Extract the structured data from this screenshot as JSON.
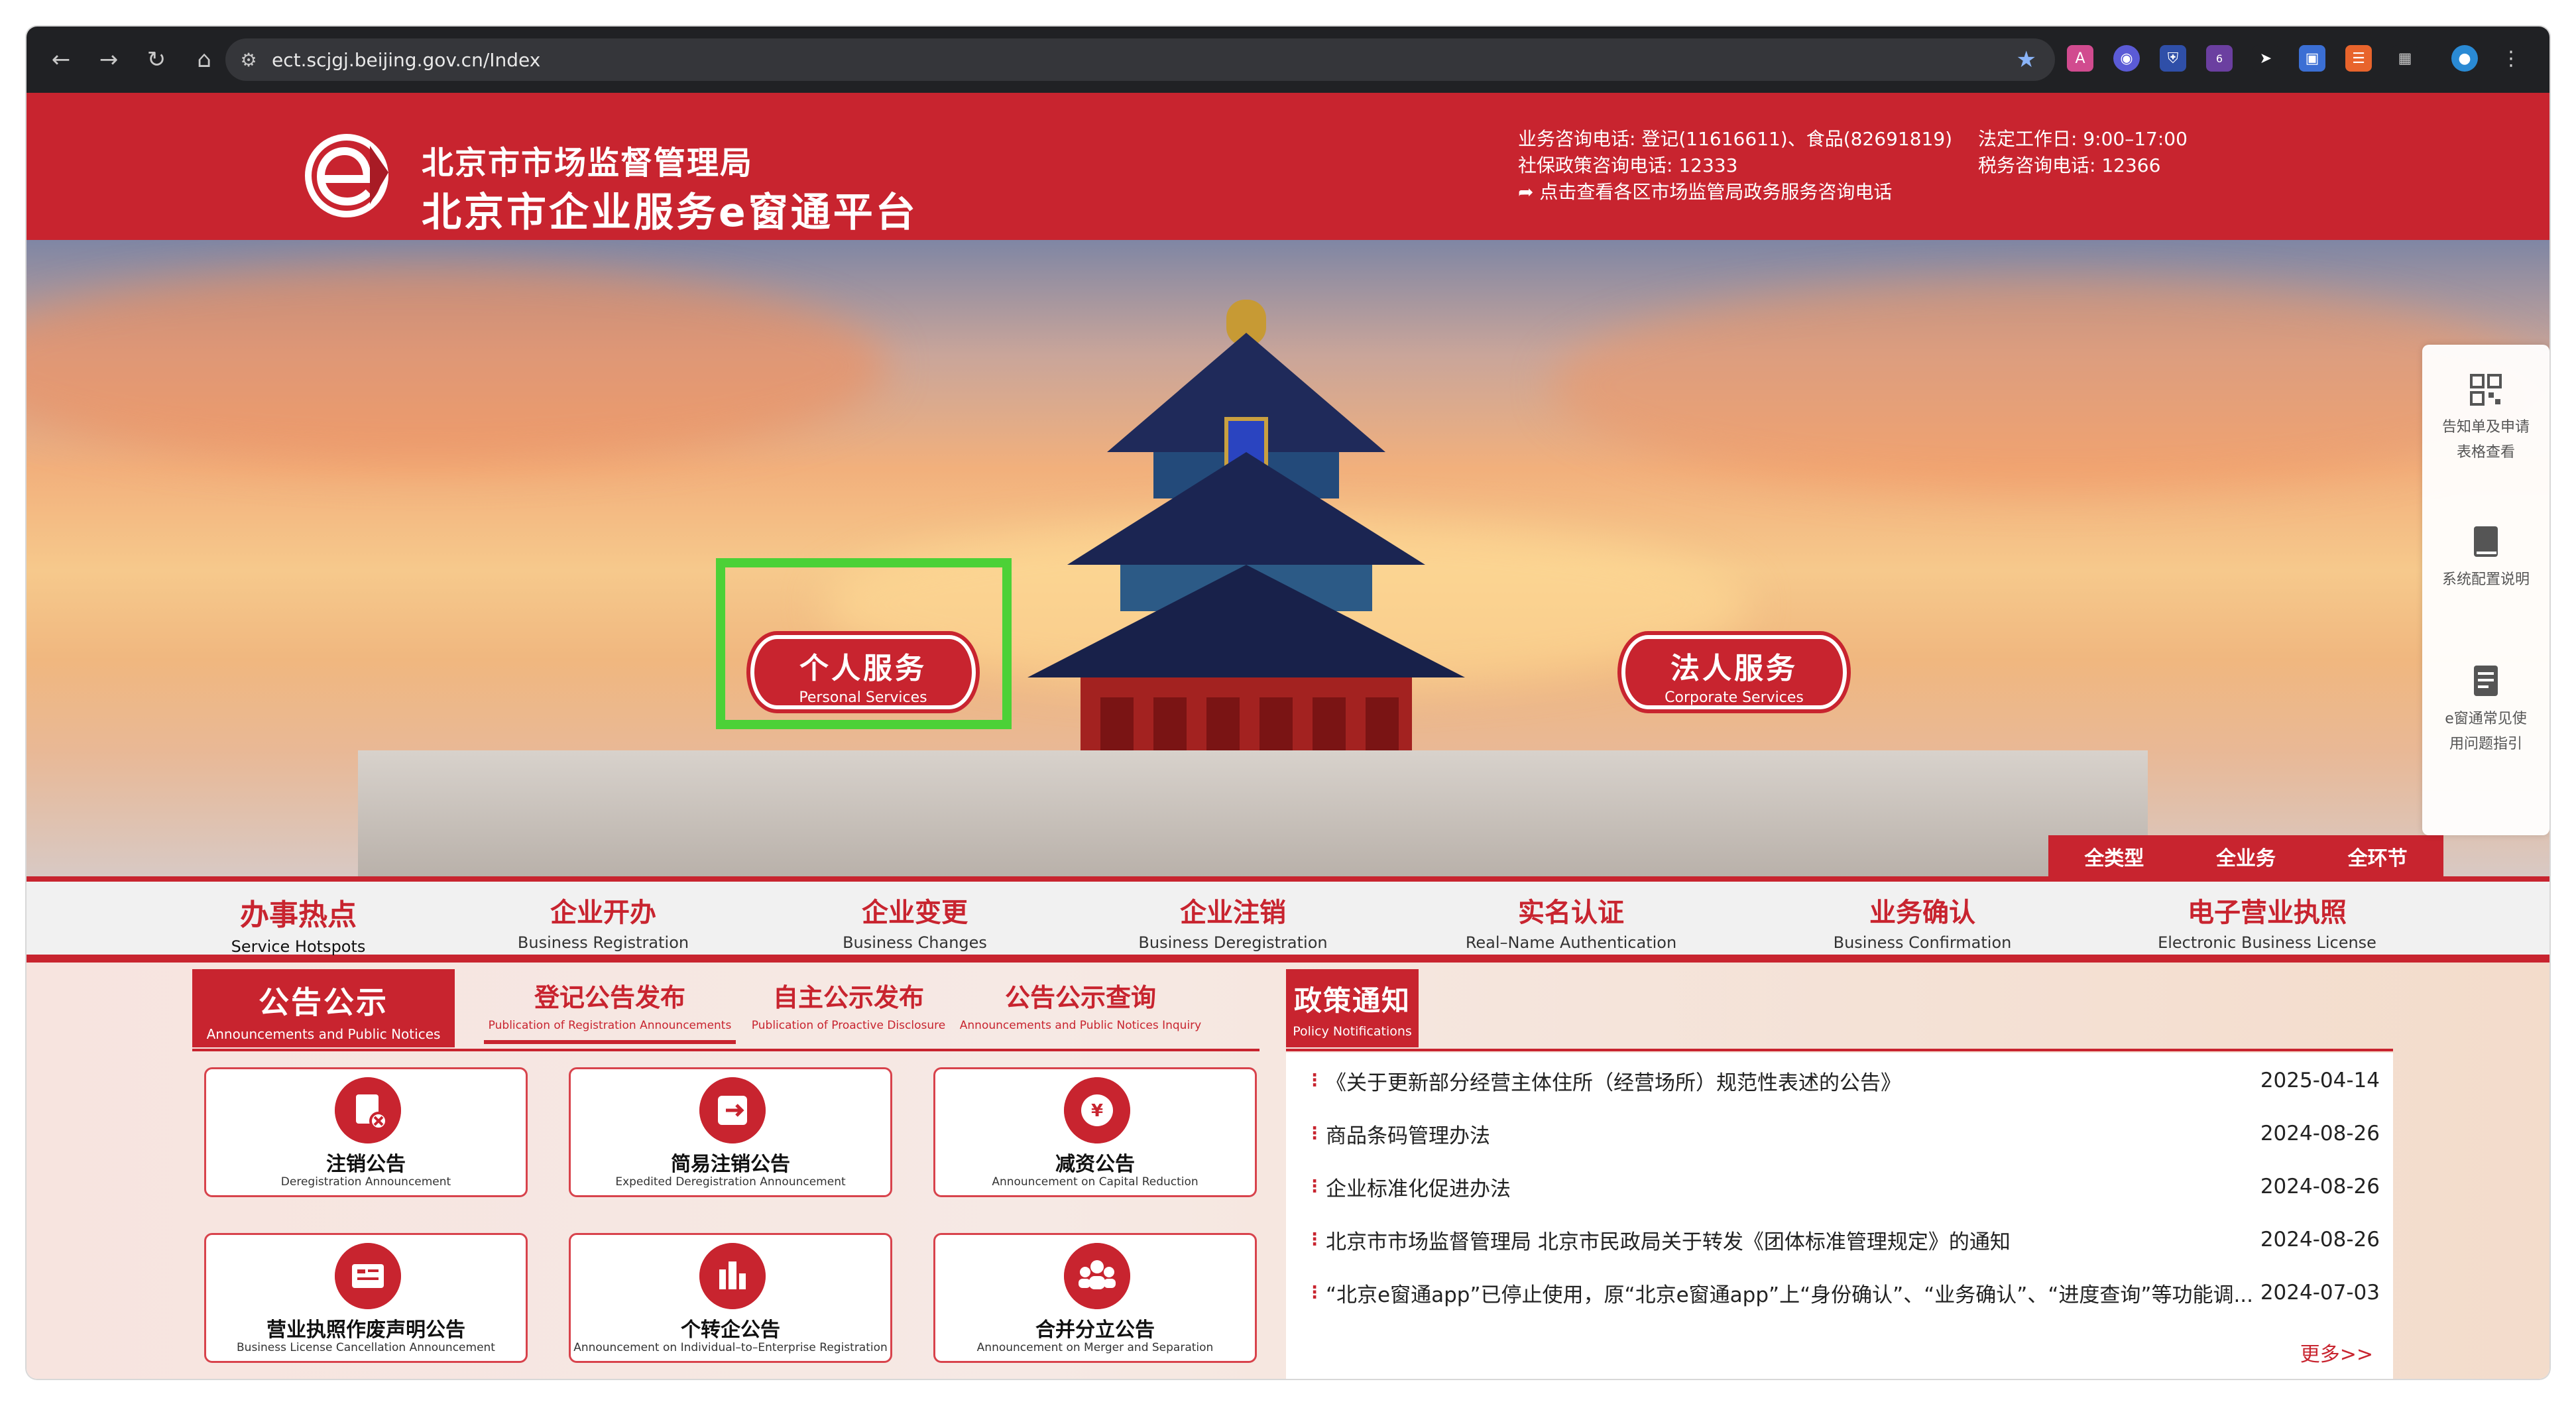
{
  "browser": {
    "url": "ect.scjgj.beijing.gov.cn/Index",
    "ext_badge": "6"
  },
  "header": {
    "org_name": "北京市市场监督管理局",
    "platform_name": "北京市企业服务e窗通平台",
    "contact_business": "业务咨询电话: 登记(11616611)、食品(82691819)",
    "contact_social": "社保政策咨询电话:   12333",
    "contact_link": "点击查看各区市场监管局政务服务咨询电话",
    "work_hours": "法定工作日:   9:00–17:00",
    "tax_phone": "税务咨询电话:   12366"
  },
  "hero": {
    "personal_zh": "个人服务",
    "personal_en": "Personal Services",
    "corporate_zh": "法人服务",
    "corporate_en": "Corporate Services",
    "quick_tabs": [
      "全类型",
      "全业务",
      "全环节"
    ]
  },
  "float_bar": [
    {
      "label_1": "告知单及申请",
      "label_2": "表格查看",
      "icon": "qr-code-icon"
    },
    {
      "label_1": "系统配置说明",
      "label_2": "",
      "icon": "book-icon"
    },
    {
      "label_1": "e窗通常见使",
      "label_2": "用问题指引",
      "icon": "document-icon"
    }
  ],
  "categories": [
    {
      "zh": "办事热点",
      "en": "Service Hotspots"
    },
    {
      "zh": "企业开办",
      "en": "Business Registration"
    },
    {
      "zh": "企业变更",
      "en": "Business Changes"
    },
    {
      "zh": "企业注销",
      "en": "Business Deregistration"
    },
    {
      "zh": "实名认证",
      "en": "Real–Name Authentication"
    },
    {
      "zh": "业务确认",
      "en": "Business Confirmation"
    },
    {
      "zh": "电子营业执照",
      "en": "Electronic Business License"
    }
  ],
  "announcements": {
    "main_zh": "公告公示",
    "main_en": "Announcements and Public Notices",
    "subtabs": [
      {
        "zh": "登记公告发布",
        "en": "Publication of Registration Announcements"
      },
      {
        "zh": "自主公示发布",
        "en": "Publication of Proactive Disclosure"
      },
      {
        "zh": "公告公示查询",
        "en": "Announcements and Public Notices Inquiry"
      }
    ],
    "cards": [
      {
        "zh": "注销公告",
        "en": "Deregistration Announcement",
        "icon": "document-cancel-icon"
      },
      {
        "zh": "简易注销公告",
        "en": "Expedited Deregistration Announcement",
        "icon": "exit-icon"
      },
      {
        "zh": "减资公告",
        "en": "Announcement on Capital Reduction",
        "icon": "yen-icon"
      },
      {
        "zh": "营业执照作废声明公告",
        "en": "Business License Cancellation Announcement",
        "icon": "license-icon"
      },
      {
        "zh": "个转企公告",
        "en": "Announcement on Individual–to–Enterprise Registration",
        "icon": "building-icon"
      },
      {
        "zh": "合并分立公告",
        "en": "Announcement on Merger and Separation",
        "icon": "group-icon"
      }
    ]
  },
  "policy": {
    "tab_zh": "政策通知",
    "tab_en": "Policy Notifications",
    "items": [
      {
        "title": "《关于更新部分经营主体住所（经营场所）规范性表述的公告》",
        "date": "2025-04-14"
      },
      {
        "title": "商品条码管理办法",
        "date": "2024-08-26"
      },
      {
        "title": "企业标准化促进办法",
        "date": "2024-08-26"
      },
      {
        "title": "北京市市场监督管理局 北京市民政局关于转发《团体标准管理规定》的通知",
        "date": "2024-08-26"
      },
      {
        "title": "“北京e窗通app”已停止使用，原“北京e窗通app”上“身份确认”、“业务确认”、“进度查询”等功能调...",
        "date": "2024-07-03"
      }
    ],
    "more": "更多>>"
  }
}
